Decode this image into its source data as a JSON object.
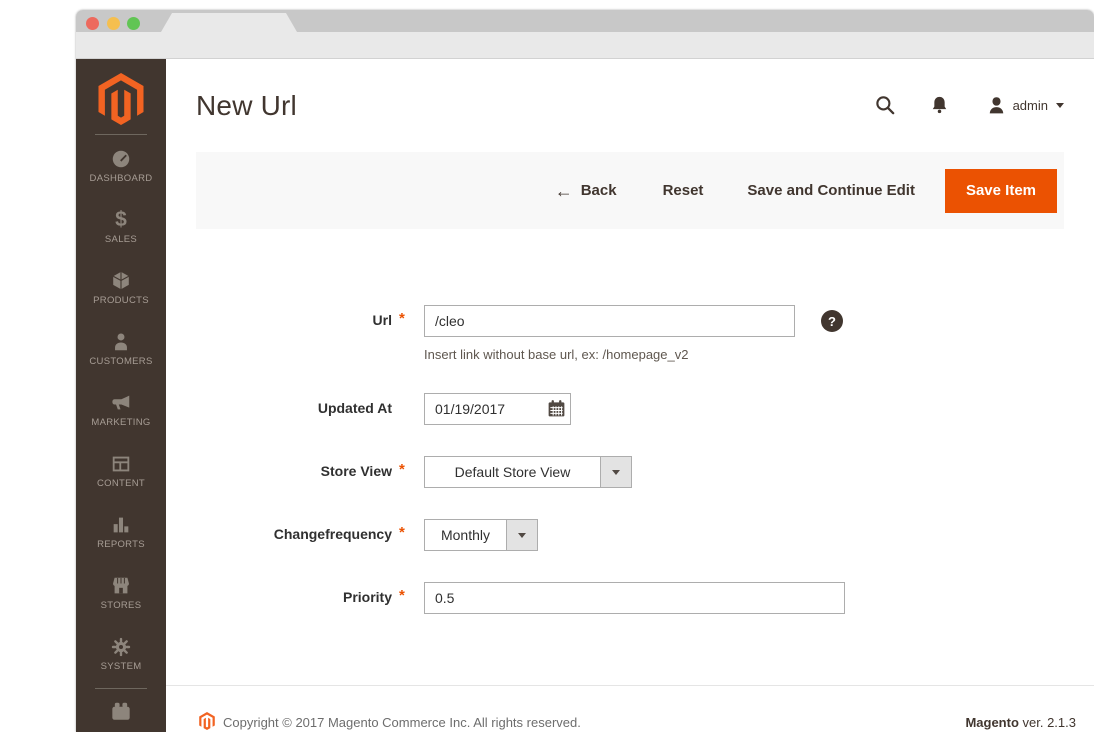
{
  "header": {
    "title": "New Url",
    "user_label": "admin"
  },
  "action_bar": {
    "back_icon": "←",
    "back": "Back",
    "reset": "Reset",
    "save_and_continue": "Save and Continue Edit",
    "save_item": "Save Item"
  },
  "sidebar": {
    "sales_glyph": "$",
    "items": [
      {
        "label": "DASHBOARD"
      },
      {
        "label": "SALES"
      },
      {
        "label": "PRODUCTS"
      },
      {
        "label": "CUSTOMERS"
      },
      {
        "label": "MARKETING"
      },
      {
        "label": "CONTENT"
      },
      {
        "label": "REPORTS"
      },
      {
        "label": "STORES"
      },
      {
        "label": "SYSTEM"
      }
    ]
  },
  "form": {
    "required_mark": "*",
    "url": {
      "label": "Url",
      "value": "/cleo",
      "note": "Insert link without base url, ex: /homepage_v2",
      "help_glyph": "?"
    },
    "updated_at": {
      "label": "Updated At",
      "value": "01/19/2017"
    },
    "store_view": {
      "label": "Store View",
      "value": "Default Store View"
    },
    "changefrequency": {
      "label": "Changefrequency",
      "value": "Monthly"
    },
    "priority": {
      "label": "Priority",
      "value": "0.5"
    }
  },
  "footer": {
    "copyright": "Copyright © 2017 Magento Commerce Inc. All rights reserved.",
    "brand": "Magento",
    "version": "ver. 2.1.3"
  },
  "colors": {
    "accent_orange": "#eb5202",
    "logo_orange": "#f26322",
    "sidebar_bg": "#41362f",
    "required_mark": "#eb5202"
  }
}
